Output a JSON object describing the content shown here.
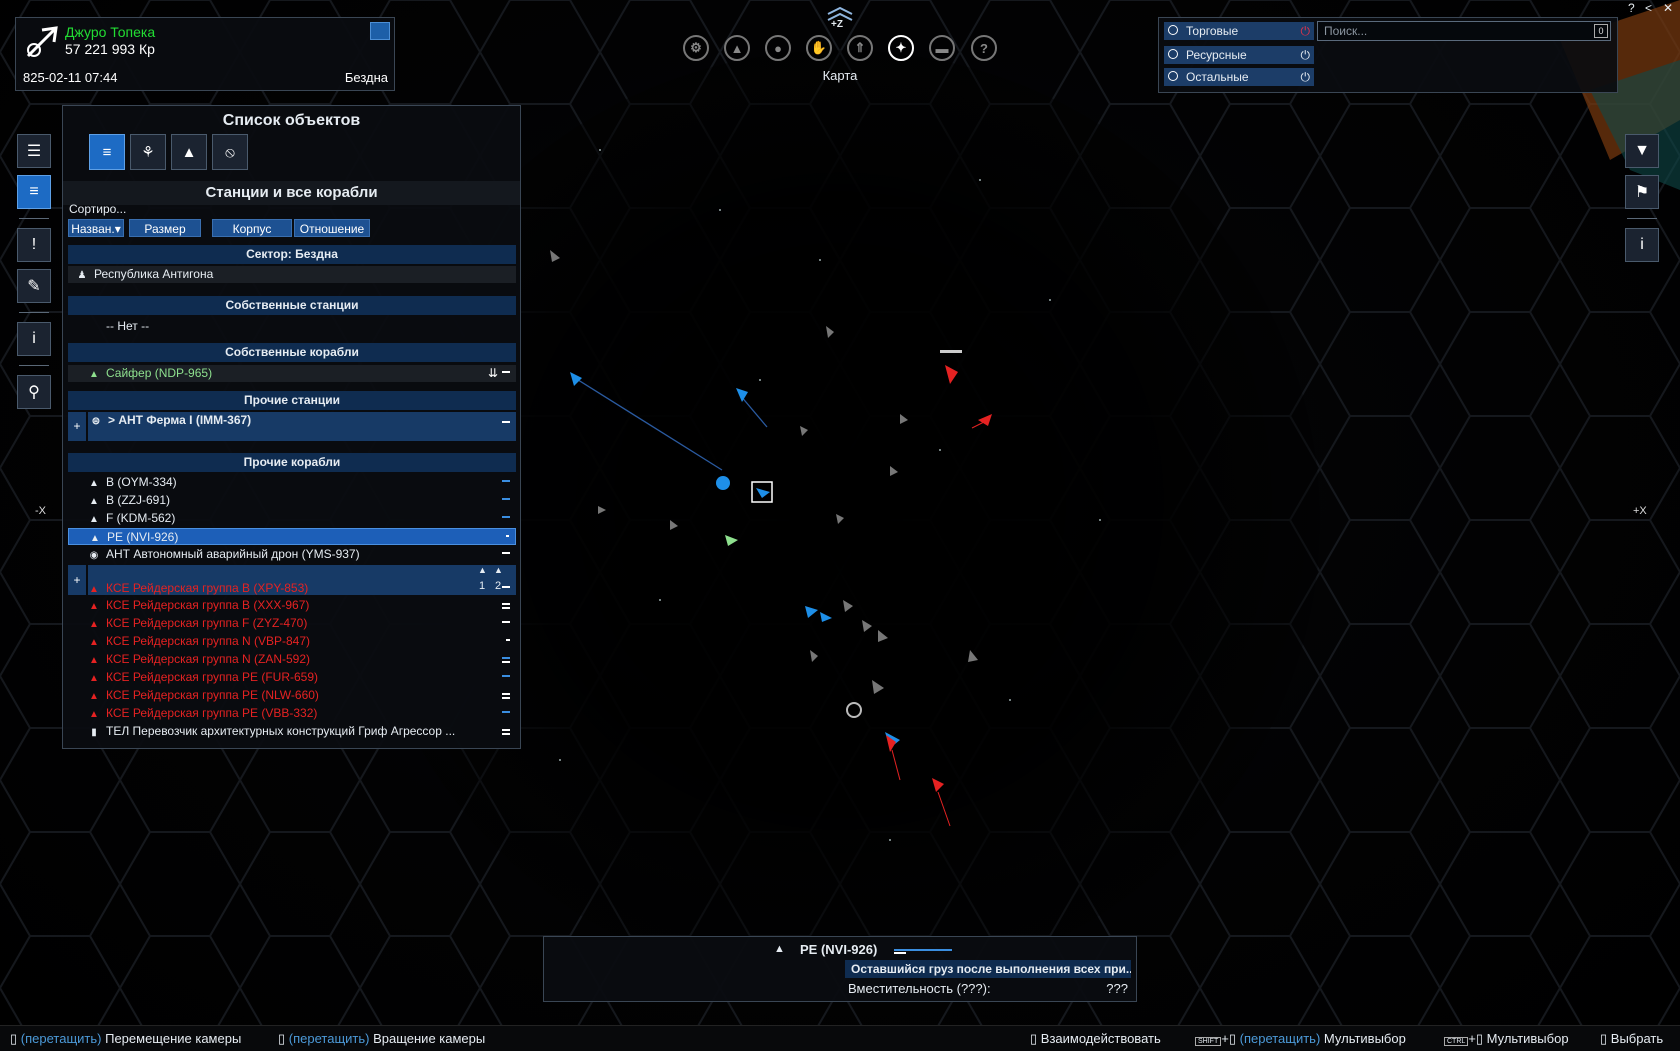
{
  "player": {
    "name": "Джуро Топека",
    "money": "57 221 993 Кр",
    "datetime": "825-02-11 07:44",
    "sector": "Бездна"
  },
  "top_toolbar": {
    "z_label": "+Z",
    "active_label": "Карта",
    "icons": [
      "gear-icon",
      "ship-icon",
      "person-icon",
      "handshake-icon",
      "rocket-icon",
      "map-icon",
      "book-icon",
      "help-icon"
    ]
  },
  "window_controls": [
    "?",
    "<",
    "✕"
  ],
  "axes": {
    "minus_x": "-X",
    "plus_x": "+X"
  },
  "object_list": {
    "title": "Список объектов",
    "subtitle": "Станции и все корабли",
    "sorting_label": "Сортиро...",
    "sort_buttons": [
      "Назван.▾",
      "Размер",
      "Корпус",
      "Отношение"
    ],
    "sector_header": "Сектор: Бездна",
    "faction_row": "Республика Антигона",
    "own_stations_header": "Собственные станции",
    "own_stations_empty": "-- Нет --",
    "own_ships_header": "Собственные корабли",
    "own_ship": "Сайфер (NDP-965)",
    "other_stations_header": "Прочие станции",
    "other_station": "> АНТ Ферма I (IMM-367)",
    "other_ships_header": "Прочие корабли",
    "other_ships": [
      "B (OYM-334)",
      "B (ZZJ-691)",
      "F (KDM-562)",
      "PE  (NVI-926)",
      "АНТ Автономный аварийный дрон (YMS-937)"
    ],
    "group_counts": [
      "1",
      "2"
    ],
    "hostile_ships": [
      "КСЕ Рейдерская группа B (XPY-853)",
      "КСЕ Рейдерская группа B (XXX-967)",
      "КСЕ Рейдерская группа F (ZYZ-470)",
      "КСЕ Рейдерская группа N (VBP-847)",
      "КСЕ Рейдерская группа N (ZAN-592)",
      "КСЕ Рейдерская группа PE  (FUR-659)",
      "КСЕ Рейдерская группа PE  (NLW-660)",
      "КСЕ Рейдерская группа PE  (VBB-332)"
    ],
    "last_ship": "ТЕЛ Перевозчик архитектурных конструкций Гриф Агрессор ..."
  },
  "filters": {
    "items": [
      "Торговые",
      "Ресурсные",
      "Остальные"
    ],
    "search_placeholder": "Поиск...",
    "search_count": "0",
    "colors": {
      "trade_power": "#e0324a",
      "other_power": "#ffffff"
    }
  },
  "info_panel": {
    "ship_name": "PE  (NVI-926)",
    "cargo_header": "Оставшийся груз после выполнения всех при...",
    "capacity_label": "Вместительность (???):",
    "capacity_value": "???"
  },
  "bottom_hints": [
    {
      "key": "(перетащить)",
      "label": "Перемещение камеры"
    },
    {
      "key": "(перетащить)",
      "label": "Вращение камеры"
    },
    {
      "key": "",
      "label": "Взаимодействовать"
    },
    {
      "key": "(перетащить)",
      "label": "Мультивыбор"
    },
    {
      "key": "",
      "label": "Мультивыбор"
    },
    {
      "key": "",
      "label": "Выбрать"
    }
  ],
  "key_caps": {
    "shift": "SHIFT",
    "ctrl": "CTRL"
  },
  "colors": {
    "accent": "#1d6bc4",
    "hostile": "#e52222",
    "own": "#8ee08e",
    "friendly": "#1e8fe8"
  }
}
